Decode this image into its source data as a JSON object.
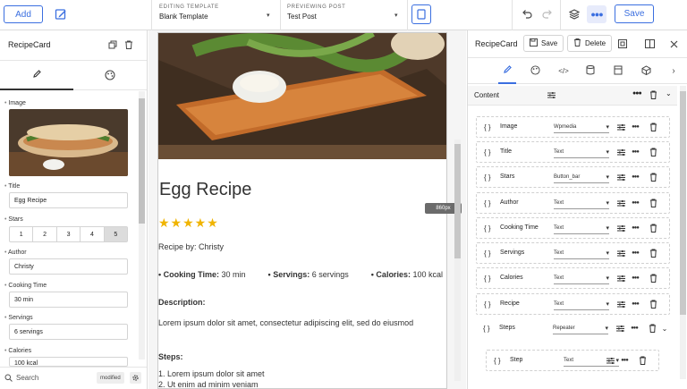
{
  "topbar": {
    "add_label": "Add",
    "editing_label": "EDITING TEMPLATE",
    "editing_value": "Blank Template",
    "previewing_label": "PREVIEWING POST",
    "previewing_value": "Test Post",
    "save_label": "Save"
  },
  "left": {
    "title": "RecipeCard",
    "fields": {
      "image_label": "Image",
      "title_label": "Title",
      "title_value": "Egg Recipe",
      "stars_label": "Stars",
      "stars_options": [
        "1",
        "2",
        "3",
        "4",
        "5"
      ],
      "stars_selected": 5,
      "author_label": "Author",
      "author_value": "Christy",
      "cooking_label": "Cooking Time",
      "cooking_value": "30 min",
      "servings_label": "Servings",
      "servings_value": "6 servings",
      "calories_label": "Calories",
      "calories_value": "100 kcal"
    },
    "footer": {
      "search": "Search",
      "badge": "modified"
    }
  },
  "preview": {
    "title": "Egg Recipe",
    "stars": "★★★★★",
    "byline": "Recipe by: Christy",
    "cook_label": "• Cooking Time:",
    "cook_value": " 30 min",
    "serv_label": "• Servings:",
    "serv_value": " 6 servings",
    "cal_label": "• Calories:",
    "cal_value": " 100 kcal",
    "desc_label": "Description:",
    "desc_text": "Lorem ipsum dolor sit amet, consectetur adipiscing elit, sed do eiusmod",
    "steps_label": "Steps:",
    "step1": "1. Lorem ipsum dolor sit amet",
    "step2": "2. Ut enim ad minim veniam",
    "width_tag": "860px"
  },
  "right": {
    "title": "RecipeCard",
    "save_label": "Save",
    "delete_label": "Delete",
    "content_label": "Content",
    "rows": [
      {
        "name": "Image",
        "type": "Wpmedia"
      },
      {
        "name": "Title",
        "type": "Text"
      },
      {
        "name": "Stars",
        "type": "Button_bar"
      },
      {
        "name": "Author",
        "type": "Text"
      },
      {
        "name": "Cooking Time",
        "type": "Text"
      },
      {
        "name": "Servings",
        "type": "Text"
      },
      {
        "name": "Calories",
        "type": "Text"
      },
      {
        "name": "Recipe",
        "type": "Text"
      },
      {
        "name": "Steps",
        "type": "Repeater"
      },
      {
        "name": "Step",
        "type": "Text"
      }
    ]
  },
  "colors": {
    "accent": "#3b6fe0",
    "star": "#f0b400"
  }
}
